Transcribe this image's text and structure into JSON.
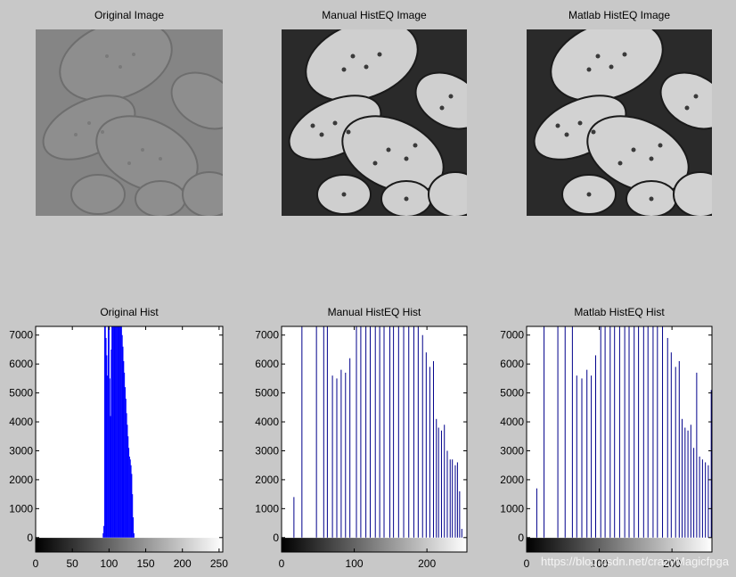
{
  "images": [
    {
      "title": "Original Image",
      "style": "low-contrast"
    },
    {
      "title": "Manual HistEQ Image",
      "style": "equalized"
    },
    {
      "title": "Matlab HistEQ Image",
      "style": "equalized"
    }
  ],
  "chart_data": [
    {
      "type": "bar",
      "title": "Original Hist",
      "xlim": [
        0,
        255
      ],
      "ylim": [
        -500,
        7300
      ],
      "xticks": [
        0,
        50,
        100,
        150,
        200,
        250
      ],
      "yticks": [
        0,
        1000,
        2000,
        3000,
        4000,
        5000,
        6000,
        7000
      ],
      "grayscale_colorbar": true,
      "bar_color": "#0000ff",
      "x": [
        92,
        93,
        94,
        95,
        96,
        97,
        98,
        99,
        100,
        101,
        102,
        103,
        104,
        105,
        106,
        107,
        108,
        109,
        110,
        111,
        112,
        113,
        114,
        115,
        116,
        117,
        118,
        119,
        120,
        121,
        122,
        123,
        124,
        125,
        126,
        127,
        128,
        129,
        130,
        131,
        132,
        133,
        134
      ],
      "values": [
        150,
        400,
        7300,
        7300,
        6900,
        6300,
        5600,
        7300,
        7300,
        5500,
        4200,
        6500,
        7300,
        7300,
        7300,
        7300,
        7300,
        7300,
        7300,
        7300,
        7300,
        7300,
        7300,
        7300,
        7300,
        7300,
        7000,
        6600,
        6100,
        5700,
        5200,
        4800,
        4300,
        3900,
        3500,
        3100,
        2800,
        2700,
        2500,
        2200,
        1500,
        700,
        150
      ]
    },
    {
      "type": "bar",
      "title": "Manual HistEQ Hist",
      "xlim": [
        0,
        255
      ],
      "ylim": [
        -500,
        7300
      ],
      "xticks": [
        0,
        100,
        200
      ],
      "yticks": [
        0,
        1000,
        2000,
        3000,
        4000,
        5000,
        6000,
        7000
      ],
      "grayscale_colorbar": true,
      "bar_color": "#00008b",
      "x": [
        17,
        28,
        48,
        58,
        63,
        70,
        76,
        82,
        88,
        94,
        103,
        109,
        116,
        122,
        129,
        135,
        141,
        149,
        154,
        161,
        168,
        175,
        182,
        188,
        194,
        199,
        204,
        209,
        213,
        216,
        220,
        224,
        228,
        232,
        235,
        239,
        242,
        245,
        248
      ],
      "values": [
        1400,
        7300,
        7300,
        7300,
        7300,
        5600,
        5500,
        5800,
        5700,
        6200,
        7300,
        7300,
        7300,
        7300,
        7300,
        7300,
        7300,
        7300,
        7300,
        7300,
        7300,
        7300,
        7300,
        7300,
        7000,
        6400,
        5900,
        6100,
        4100,
        3800,
        3700,
        3900,
        3000,
        2700,
        2700,
        2500,
        2600,
        1600,
        300
      ]
    },
    {
      "type": "bar",
      "title": "Matlab HistEQ Hist",
      "xlim": [
        0,
        255
      ],
      "ylim": [
        -500,
        7300
      ],
      "xticks": [
        0,
        100,
        200
      ],
      "yticks": [
        0,
        1000,
        2000,
        3000,
        4000,
        5000,
        6000,
        7000
      ],
      "grayscale_colorbar": true,
      "bar_color": "#00008b",
      "x": [
        14,
        24,
        43,
        53,
        63,
        69,
        76,
        83,
        89,
        95,
        102,
        108,
        115,
        121,
        128,
        135,
        141,
        148,
        154,
        161,
        167,
        174,
        180,
        187,
        194,
        199,
        205,
        210,
        214,
        218,
        222,
        226,
        230,
        234,
        238,
        242,
        246,
        250,
        254
      ],
      "values": [
        1700,
        7300,
        7300,
        7300,
        7300,
        5600,
        5500,
        5800,
        5600,
        6300,
        7300,
        7300,
        7300,
        7300,
        7300,
        7300,
        7300,
        7300,
        7300,
        7300,
        7300,
        7300,
        7300,
        7300,
        6900,
        6400,
        5900,
        6100,
        4100,
        3800,
        3700,
        3900,
        3100,
        5700,
        2800,
        2700,
        2600,
        2500,
        5100
      ]
    }
  ],
  "watermark": "https://blog.csdn.net/crazyMagicfpga"
}
